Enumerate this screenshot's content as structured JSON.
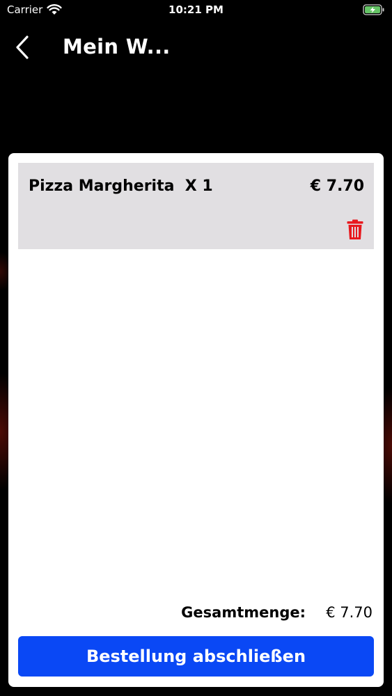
{
  "status_bar": {
    "carrier": "Carrier",
    "time": "10:21 PM",
    "icons": [
      "wifi-icon",
      "battery-charging-icon"
    ]
  },
  "nav": {
    "title": "Mein W...",
    "back_icon": "chevron-left-icon"
  },
  "cart": {
    "items": [
      {
        "name": "Pizza Margherita  X 1",
        "price": "€ 7.70",
        "delete_icon": "trash-icon"
      }
    ],
    "total_label": "Gesamtmenge:",
    "total_value": "€ 7.70",
    "checkout_label": "Bestellung abschließen"
  },
  "colors": {
    "background": "#000000",
    "card": "#ffffff",
    "item_background": "#e1dfe2",
    "delete": "#e8191e",
    "button": "#0a48f5",
    "battery": "#65c466"
  }
}
